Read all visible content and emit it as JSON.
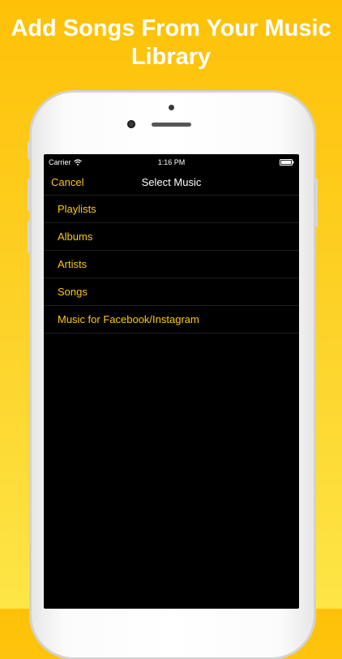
{
  "promo": {
    "title_line1": "Add Songs From Your Music",
    "title_line2": "Library"
  },
  "status_bar": {
    "carrier": "Carrier",
    "time": "1:16 PM",
    "battery_level": 1.0
  },
  "nav": {
    "cancel_label": "Cancel",
    "title": "Select Music"
  },
  "menu": {
    "items": [
      {
        "label": "Playlists"
      },
      {
        "label": "Albums"
      },
      {
        "label": "Artists"
      },
      {
        "label": "Songs"
      },
      {
        "label": "Music for Facebook/Instagram"
      }
    ]
  },
  "colors": {
    "accent": "#fdc80f",
    "background_top": "#fec107",
    "background_bottom": "#fde646",
    "screen": "#000000"
  },
  "icons": [
    "wifi-icon",
    "battery-icon"
  ]
}
